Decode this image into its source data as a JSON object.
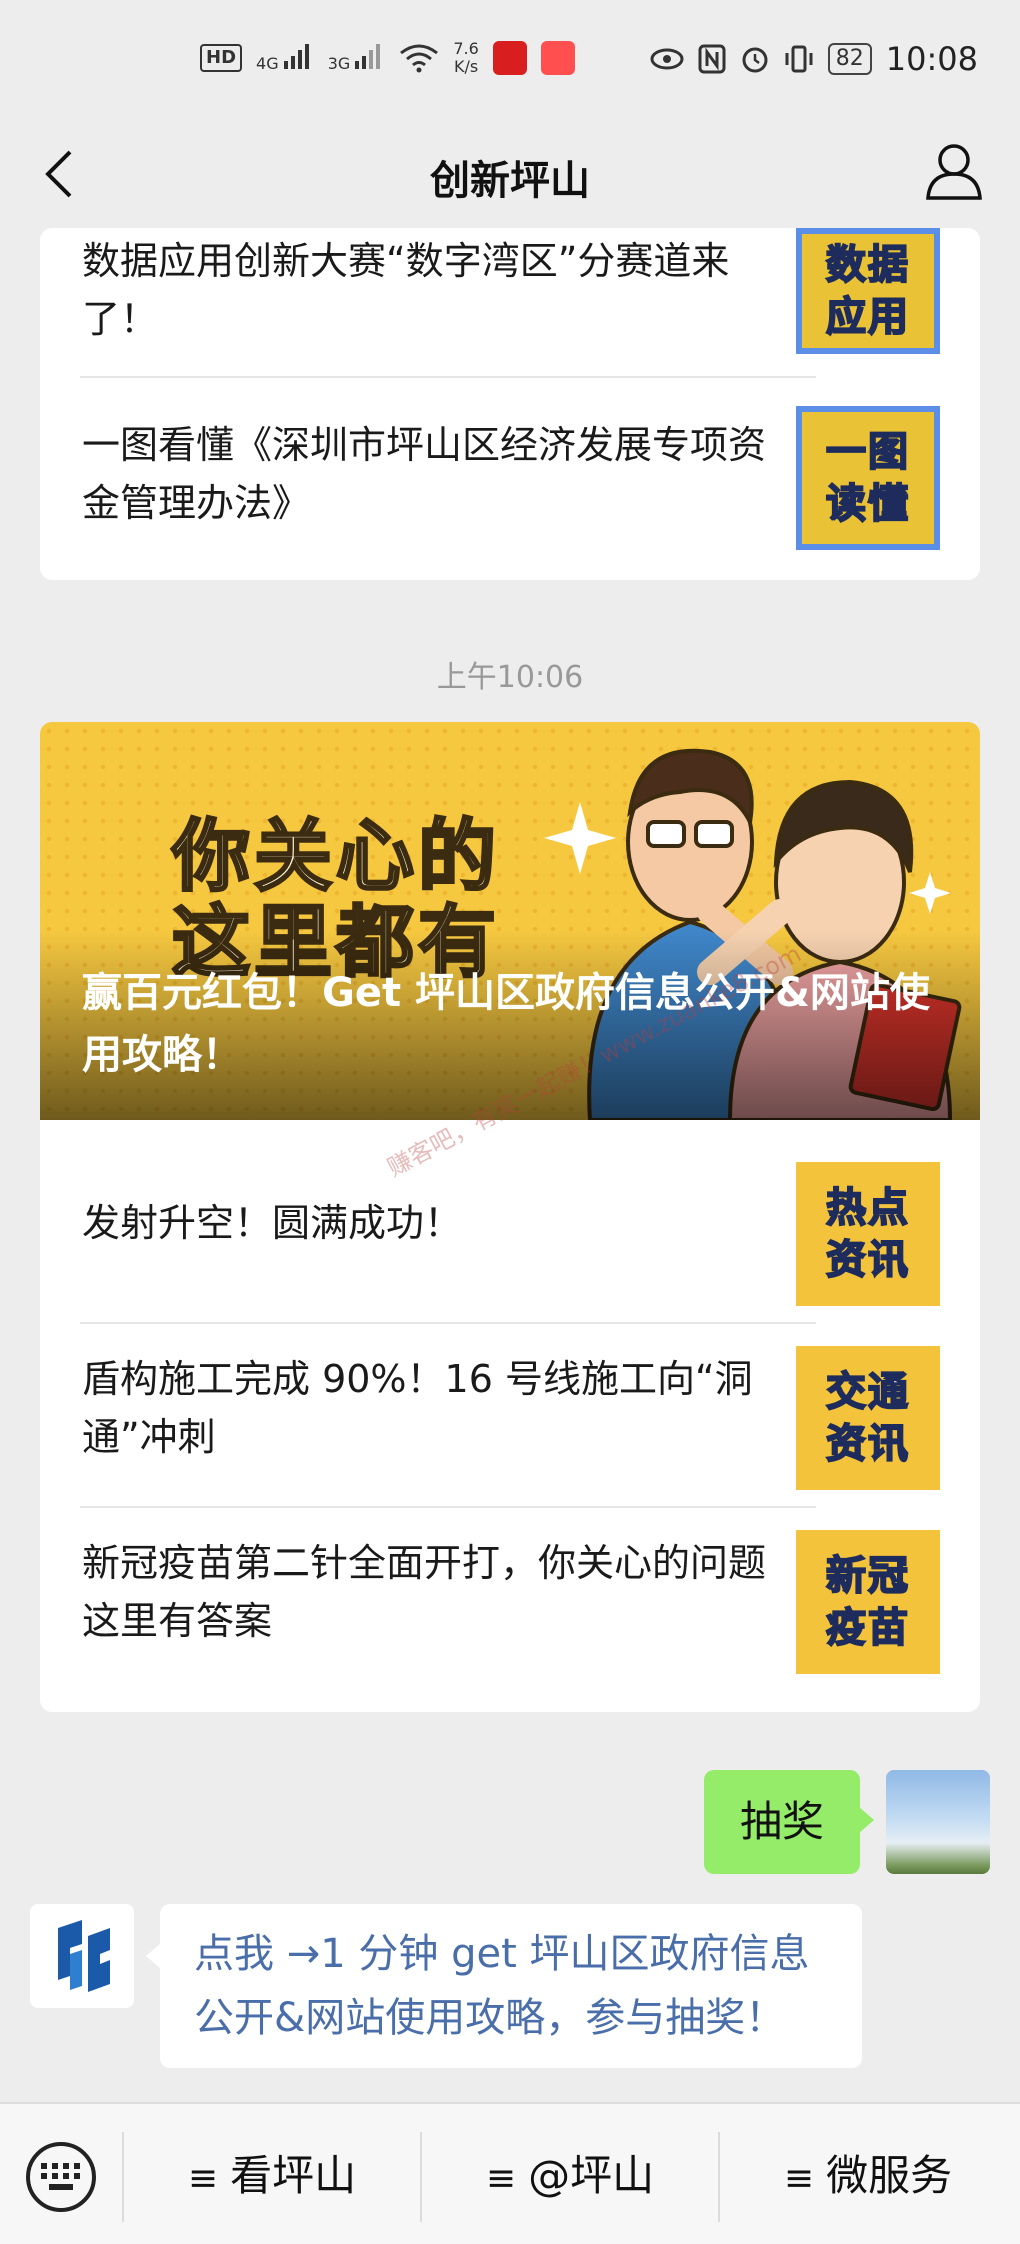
{
  "status_bar": {
    "hd": "HD",
    "net1": "4G",
    "net2": "3G",
    "speed_value": "7.6",
    "speed_unit": "K/s",
    "battery": "82",
    "time": "10:08"
  },
  "nav": {
    "title": "创新坪山"
  },
  "card1": {
    "items": [
      {
        "title": "数据应用创新大赛“数字湾区”分赛道来了！",
        "thumb": "数据应用",
        "thumb_color": "#e9c235"
      },
      {
        "title": "一图看懂《深圳市坪山区经济发展专项资金管理办法》",
        "thumb": "一图读懂",
        "thumb_color": "#e9c235"
      }
    ]
  },
  "timestamp": "上午10:06",
  "card2": {
    "banner_art_text": "你关心的这里都有",
    "banner_title": "赢百元红包！Get 坪山区政府信息公开&网站使用攻略！",
    "watermark": "赚客吧，有奖一起赚！www.zuanke8.com",
    "items": [
      {
        "title": "发射升空！圆满成功！",
        "thumb": "热点资讯",
        "thumb_color": "#f3c33b"
      },
      {
        "title": "盾构施工完成 90%！16 号线施工向“洞通”冲刺",
        "thumb": "交通资讯",
        "thumb_color": "#f3c33b"
      },
      {
        "title": "新冠疫苗第二针全面开打，你关心的问题这里有答案",
        "thumb": "新冠疫苗",
        "thumb_color": "#f3c33b"
      }
    ]
  },
  "chat": {
    "my_message": "抽奖",
    "bot_message": "点我 →1 分钟 get 坪山区政府信息公开&网站使用攻略，参与抽奖！"
  },
  "menu": {
    "items": [
      "看坪山",
      "@坪山",
      "微服务"
    ]
  },
  "colors": {
    "background": "#ededed",
    "my_bubble": "#95ec69",
    "bot_link": "#4a6ea9",
    "banner": "#f6c840",
    "thumb_frame": "#5b8ee6"
  }
}
